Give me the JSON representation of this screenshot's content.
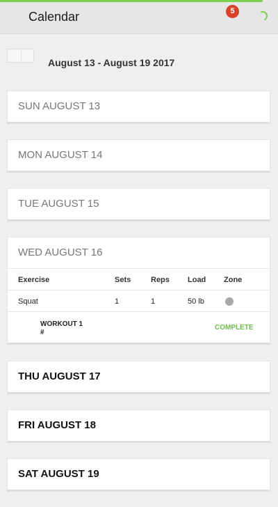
{
  "header": {
    "title": "Calendar",
    "badge_count": "5",
    "accent_color": "#7cd14a",
    "badge_color": "#d9432b"
  },
  "week": {
    "prev_icon": "chevron-left-icon",
    "next_icon": "chevron-right-icon",
    "range": "August 13 - August 19 2017"
  },
  "days": [
    {
      "label": "SUN AUGUST 13"
    },
    {
      "label": "MON AUGUST 14"
    },
    {
      "label": "TUE AUGUST 15"
    },
    {
      "label": "WED AUGUST 16"
    },
    {
      "label": "THU AUGUST 17"
    },
    {
      "label": "FRI AUGUST 18"
    },
    {
      "label": "SAT AUGUST 19"
    }
  ],
  "workout": {
    "columns": [
      "Exercise",
      "Sets",
      "Reps",
      "Load",
      "Zone"
    ],
    "rows": [
      {
        "exercise": "Squat",
        "sets": "1",
        "reps": "1",
        "load": "50 lb",
        "zone_color": "#a8a8a8"
      }
    ],
    "name": "WORKOUT 1",
    "hash": "#",
    "status": "COMPLETE",
    "status_color": "#6cc04a"
  }
}
